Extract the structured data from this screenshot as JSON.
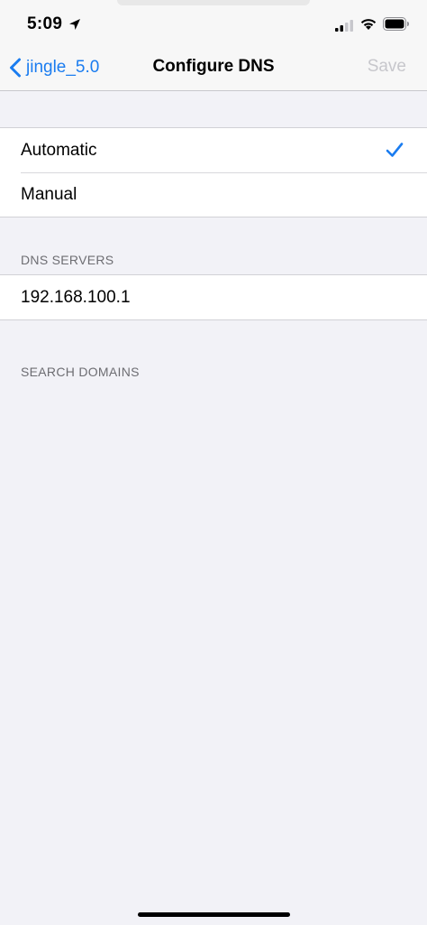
{
  "status_bar": {
    "time": "5:09",
    "icons": [
      "location-arrow-icon",
      "cellular-signal-icon",
      "wifi-icon",
      "battery-icon"
    ]
  },
  "nav": {
    "back_label": "jingle_5.0",
    "title": "Configure DNS",
    "save_label": "Save"
  },
  "dns_mode": {
    "options": [
      {
        "label": "Automatic",
        "selected": true
      },
      {
        "label": "Manual",
        "selected": false
      }
    ]
  },
  "dns_servers": {
    "header": "DNS SERVERS",
    "items": [
      "192.168.100.1"
    ]
  },
  "search_domains": {
    "header": "SEARCH DOMAINS"
  },
  "colors": {
    "accent": "#1a7cf0",
    "background": "#f2f2f7",
    "disabled": "#c7c7cc"
  }
}
